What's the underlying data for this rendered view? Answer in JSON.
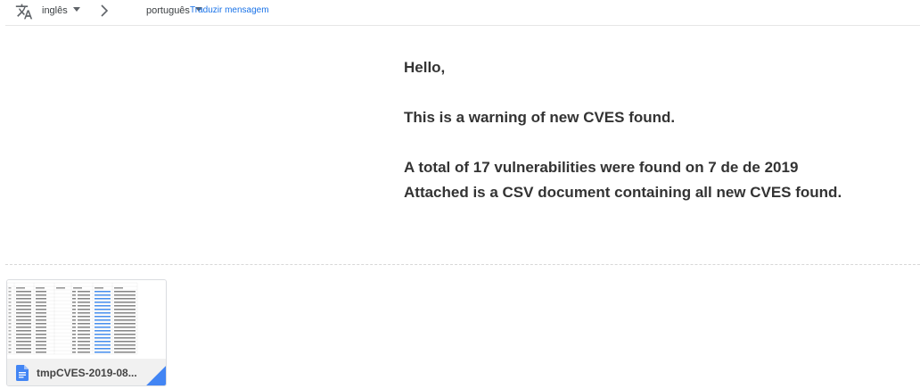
{
  "translate_bar": {
    "source_language": "inglês",
    "target_language": "português",
    "translate_link": "Traduzir mensagem",
    "icons": {
      "translate": "translate-icon",
      "chevron": "chevron-right-icon",
      "dropdown": "caret-down-icon"
    }
  },
  "message": {
    "greeting": "Hello,",
    "line1": "This is a warning of new CVES found.",
    "line2": "A total of 17 vulnerabilities were found on 7 de de 2019",
    "line3": "Attached is a CSV document containing all new CVES found."
  },
  "attachment": {
    "filename": "tmpCVES-2019-08...",
    "icon": "google-docs-icon",
    "accent_color": "#4285f4"
  }
}
